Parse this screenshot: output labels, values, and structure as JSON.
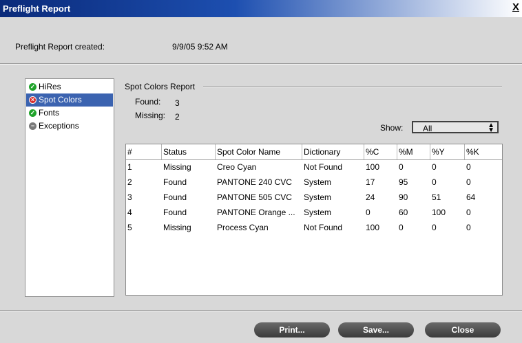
{
  "window": {
    "title": "Preflight Report",
    "close_glyph": "X"
  },
  "info": {
    "created_label": "Preflight Report created:",
    "created_value": "9/9/05 9:52 AM"
  },
  "nav": {
    "items": [
      {
        "label": "HiRes",
        "icon": "check-icon",
        "status": "ok"
      },
      {
        "label": "Spot Colors",
        "icon": "error-icon",
        "status": "error",
        "selected": true
      },
      {
        "label": "Fonts",
        "icon": "check-icon",
        "status": "ok"
      },
      {
        "label": "Exceptions",
        "icon": "minus-icon",
        "status": "none"
      }
    ]
  },
  "report": {
    "title": "Spot Colors Report",
    "found_label": "Found:",
    "found_value": "3",
    "missing_label": "Missing:",
    "missing_value": "2",
    "show_label": "Show:",
    "show_value": "All"
  },
  "table": {
    "columns": [
      "#",
      "Status",
      "Spot Color Name",
      "Dictionary",
      "%C",
      "%M",
      "%Y",
      "%K"
    ],
    "rows": [
      [
        "1",
        "Missing",
        "Creo Cyan",
        "Not Found",
        "100",
        "0",
        "0",
        "0"
      ],
      [
        "2",
        "Found",
        "PANTONE 240 CVC",
        "System",
        "17",
        "95",
        "0",
        "0"
      ],
      [
        "3",
        "Found",
        "PANTONE 505 CVC",
        "System",
        "24",
        "90",
        "51",
        "64"
      ],
      [
        "4",
        "Found",
        "PANTONE Orange ...",
        "System",
        "0",
        "60",
        "100",
        "0"
      ],
      [
        "5",
        "Missing",
        "Process Cyan",
        "Not Found",
        "100",
        "0",
        "0",
        "0"
      ]
    ]
  },
  "buttons": {
    "print": "Print...",
    "save": "Save...",
    "close": "Close"
  }
}
